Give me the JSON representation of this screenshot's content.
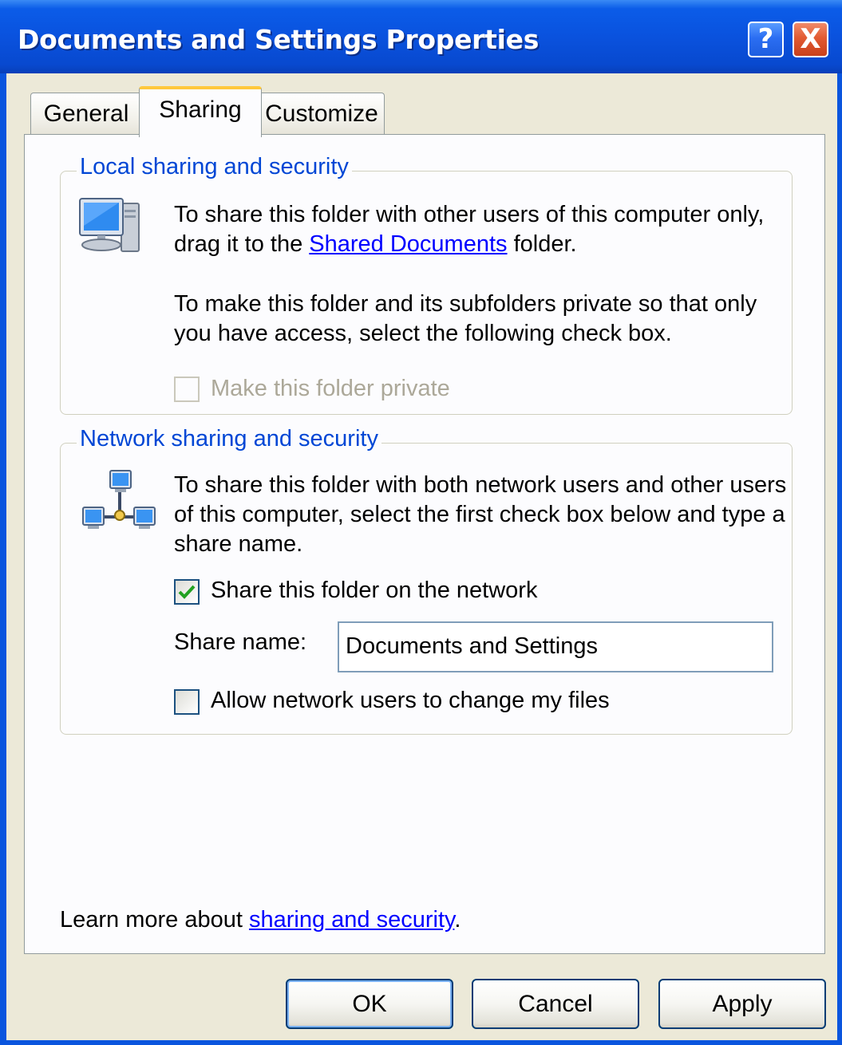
{
  "window": {
    "title": "Documents and Settings Properties",
    "help_label": "?",
    "close_label": "X"
  },
  "tabs": [
    {
      "label": "General",
      "selected": false
    },
    {
      "label": "Sharing",
      "selected": true
    },
    {
      "label": "Customize",
      "selected": false
    }
  ],
  "local": {
    "legend": "Local sharing and security",
    "text1_before": "To share this folder with other users of this computer only, drag it to the ",
    "link": "Shared Documents",
    "text1_after": " folder.",
    "text2": "To make this folder and its subfolders private so that only you have access, select the following check box.",
    "private_checkbox": {
      "label": "Make this folder private",
      "checked": false,
      "enabled": false
    }
  },
  "network": {
    "legend": "Network sharing and security",
    "text": "To share this folder with both network users and other users of this computer, select the first check box below and type a share name.",
    "share_checkbox": {
      "label": "Share this folder on the network",
      "checked": true
    },
    "share_name_label": "Share name:",
    "share_name_value": "Documents and Settings",
    "allow_checkbox": {
      "label": "Allow network users to change my files",
      "checked": false
    }
  },
  "learn_more": {
    "prefix": "Learn more about ",
    "link": "sharing and security",
    "suffix": "."
  },
  "buttons": {
    "ok": "OK",
    "cancel": "Cancel",
    "apply": "Apply"
  },
  "colors": {
    "titlebar": "#0a55de",
    "legend_text": "#0046d5",
    "link": "#0000ff",
    "dialog_bg": "#ece9d8",
    "tab_accent": "#ffc83c",
    "check_mark": "#21a121"
  }
}
